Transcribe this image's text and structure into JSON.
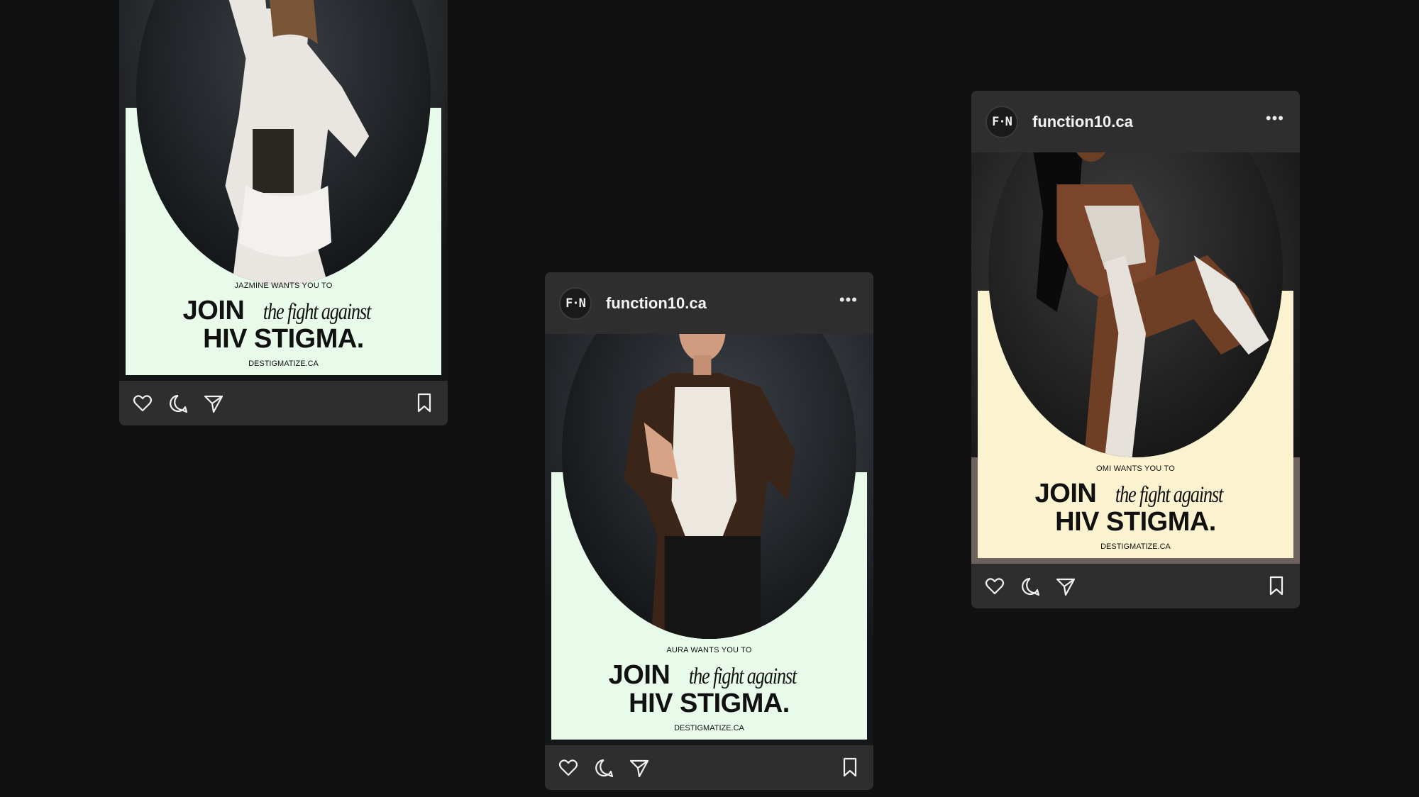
{
  "canvas": {
    "background": "#111111"
  },
  "posts": [
    {
      "id": "left",
      "username": "",
      "poster": {
        "background": "#e8faea",
        "kicker": "JAZMINE WANTS YOU TO",
        "join": "JOIN",
        "script": "the fight against",
        "hiv": "HIV STIGMA.",
        "url": "DESTIGMATIZE.CA"
      }
    },
    {
      "id": "center",
      "username": "function10.ca",
      "avatar_text": "F·N",
      "more": "•••",
      "poster": {
        "background": "#e8faea",
        "kicker": "AURA WANTS YOU TO",
        "join": "JOIN",
        "script": "the fight against",
        "hiv": "HIV STIGMA.",
        "url": "DESTIGMATIZE.CA"
      }
    },
    {
      "id": "right",
      "username": "function10.ca",
      "avatar_text": "F·N",
      "more": "•••",
      "poster": {
        "background": "#fbf2cf",
        "kicker": "OMI WANTS YOU TO",
        "join": "JOIN",
        "script": "the fight against",
        "hiv": "HIV STIGMA.",
        "url": "DESTIGMATIZE.CA"
      }
    }
  ],
  "actions": {
    "icons": [
      "heart-icon",
      "comment-icon",
      "share-icon",
      "bookmark-icon"
    ]
  }
}
